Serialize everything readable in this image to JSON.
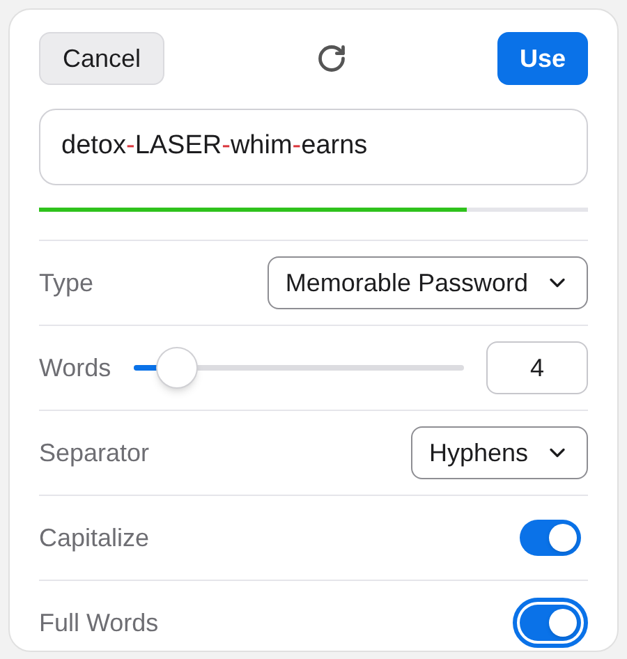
{
  "toolbar": {
    "cancel": "Cancel",
    "use": "Use"
  },
  "password_parts": [
    {
      "text": "detox",
      "kind": "word"
    },
    {
      "text": "-",
      "kind": "separator"
    },
    {
      "text": "LASER",
      "kind": "word"
    },
    {
      "text": "-",
      "kind": "separator"
    },
    {
      "text": "whim",
      "kind": "word"
    },
    {
      "text": "-",
      "kind": "separator"
    },
    {
      "text": "earns",
      "kind": "word"
    }
  ],
  "strength": {
    "level": 0.78
  },
  "options": [
    {
      "kind": "select",
      "label": "Type",
      "value": "Memorable Password"
    },
    {
      "kind": "slider",
      "label": "Words",
      "level": 0.13,
      "value": "4"
    },
    {
      "kind": "select",
      "label": "Separator",
      "value": "Hyphens"
    },
    {
      "kind": "toggle",
      "label": "Capitalize",
      "on": true,
      "focused": false
    },
    {
      "kind": "toggle",
      "label": "Full Words",
      "on": true,
      "focused": true
    }
  ]
}
